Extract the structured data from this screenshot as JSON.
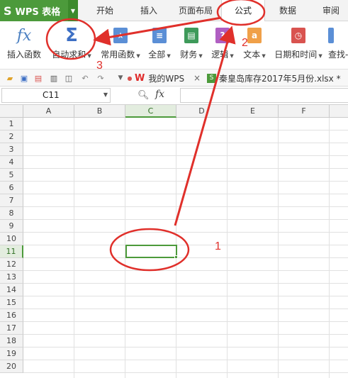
{
  "app": {
    "logo": "S",
    "name": "WPS 表格"
  },
  "ribbon_tabs": [
    "开始",
    "插入",
    "页面布局",
    "公式",
    "数据",
    "审阅"
  ],
  "ribbon": {
    "insert_function": {
      "icon": "fx",
      "label": "插入函数"
    },
    "autosum": {
      "icon": "Σ",
      "label": "自动求和"
    },
    "common_functions": {
      "label": "常用函数"
    },
    "all": {
      "label": "全部"
    },
    "finance": {
      "label": "财务"
    },
    "logic": {
      "label": "逻辑"
    },
    "text": {
      "icon": "a",
      "label": "文本"
    },
    "datetime": {
      "label": "日期和时间"
    },
    "lookup": {
      "label": "查找-"
    }
  },
  "doc_tabs": {
    "my_wps": "我的WPS",
    "close": "×",
    "workbook": "秦皇岛库存2017年5月份.xlsx *"
  },
  "formula_bar": {
    "cell_ref": "C11",
    "fx": "fx",
    "formula": ""
  },
  "columns": [
    "A",
    "B",
    "C",
    "D",
    "E",
    "F"
  ],
  "rows": [
    "1",
    "2",
    "3",
    "4",
    "5",
    "6",
    "7",
    "8",
    "9",
    "10",
    "11",
    "12",
    "13",
    "14",
    "15",
    "16",
    "17",
    "18",
    "19",
    "20"
  ],
  "annotations": {
    "step1": "1",
    "step2": "2",
    "step3": "3"
  },
  "colors": {
    "brand": "#4c9a3b",
    "annotation": "#e0302b"
  }
}
